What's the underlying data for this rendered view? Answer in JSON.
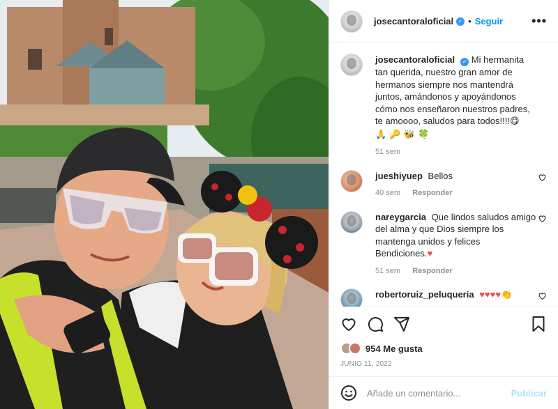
{
  "post": {
    "username": "josecantoraloficial",
    "follow_label": "Seguir",
    "more_label": "•••",
    "caption": "Mi hermanita tan querida, nuestro gran amor de hermanos siempre nos mantendrá juntos, amándonos y apoyándonos cómo nos enseñaron nuestros padres, te amoooo, saludos para todos!!!!",
    "caption_emoji_1": "😋",
    "caption_emoji_line": "🙏 🔑 🐝 🍀",
    "caption_time": "51 sem"
  },
  "comments": [
    {
      "user": "jueshiyuep",
      "text": "Bellos",
      "time": "40 sem",
      "reply": "Responder"
    },
    {
      "user": "nareygarcia",
      "text": "Que lindos saludos amigo del alma y que Dios siempre los mantenga unidos y felices Bendiciones.",
      "emoji": "♥",
      "time": "51 sem",
      "reply": "Responder"
    },
    {
      "user": "robertoruiz_peluqueria",
      "text": "♥♥♥♥",
      "emoji": "👏"
    }
  ],
  "actions": {
    "likes": "954 Me gusta",
    "date": "JUNIO 11, 2022"
  },
  "add_comment": {
    "placeholder": "Añade un comentario...",
    "publish_label": "Publicar"
  },
  "icons": {
    "like": "heart-icon",
    "comment": "comment-icon",
    "share": "share-icon",
    "save": "bookmark-icon",
    "emoji": "emoji-icon",
    "verified": "verified-badge-icon"
  },
  "colors": {
    "accent": "#0095f6",
    "verified": "#3897f0",
    "publish_disabled": "#b2dffc",
    "like_red": "#ed4956"
  }
}
